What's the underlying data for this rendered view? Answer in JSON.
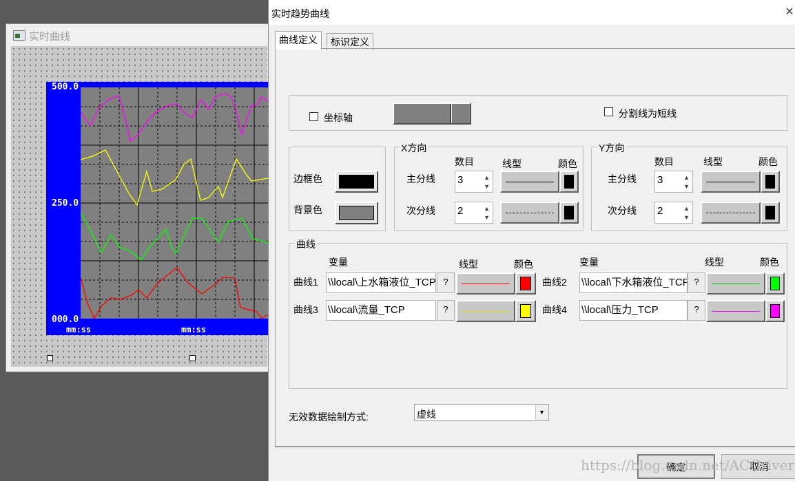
{
  "background_window": {
    "title": "实时曲线",
    "y_labels": [
      "500.0",
      "250.0",
      "000.0"
    ],
    "x_labels": [
      "mm:ss",
      "mm:ss"
    ]
  },
  "dialog": {
    "title": "实时趋势曲线",
    "close": "×",
    "tabs": [
      {
        "label": "曲线定义"
      },
      {
        "label": "标识定义"
      }
    ],
    "axis": {
      "checkbox_label": "坐标轴",
      "checked": false
    },
    "dashed_divider": {
      "checkbox_label": "分割线为短线",
      "checked": false
    },
    "frame": {
      "border_color_label": "边框色",
      "bg_color_label": "背景色"
    },
    "x_dir": {
      "title": "X方向",
      "col_count": "数目",
      "col_linetype": "线型",
      "col_color": "颜色",
      "major_label": "主分线",
      "major_count": "3",
      "minor_label": "次分线",
      "minor_count": "2"
    },
    "y_dir": {
      "title": "Y方向",
      "col_count": "数目",
      "col_linetype": "线型",
      "col_color": "颜色",
      "major_label": "主分线",
      "major_count": "3",
      "minor_label": "次分线",
      "minor_count": "2"
    },
    "curves": {
      "title": "曲线",
      "col_variable": "变量",
      "col_linetype": "线型",
      "col_color": "颜色",
      "items": [
        {
          "label": "曲线1",
          "variable": "\\\\local\\上水箱液位_TCP",
          "color": "#ff0000"
        },
        {
          "label": "曲线2",
          "variable": "\\\\local\\下水箱液位_TCP",
          "color": "#00ff00"
        },
        {
          "label": "曲线3",
          "variable": "\\\\local\\流量_TCP",
          "color": "#ffff00"
        },
        {
          "label": "曲线4",
          "variable": "\\\\local\\压力_TCP",
          "color": "#ff00ff"
        }
      ],
      "q_label": "?"
    },
    "invalid_data": {
      "label": "无效数据绘制方式:",
      "value": "虚线"
    },
    "ok": "确定",
    "cancel": "取消"
  },
  "watermark": "https://blog.csdn.net/ACGriver",
  "colors": {
    "chart_frame": "#0000ff",
    "plot_bg": "#808080",
    "frame_border_color": "#000000",
    "frame_bg_color": "#808080",
    "major_grid_color": "#000000",
    "minor_grid_color": "#000000"
  }
}
